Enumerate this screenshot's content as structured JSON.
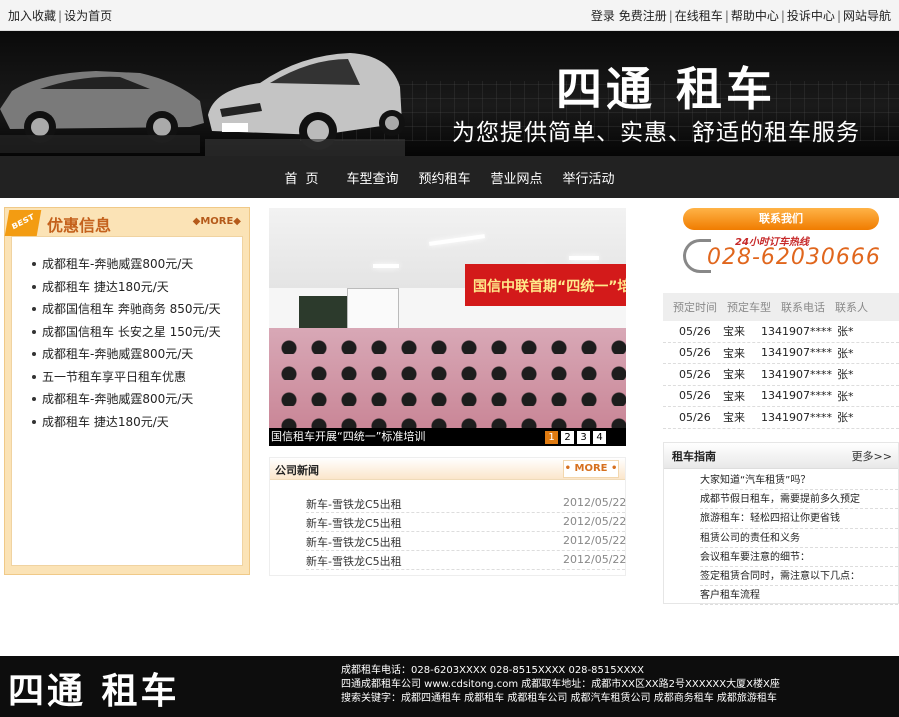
{
  "topbar": {
    "left": [
      "加入收藏",
      "设为首页"
    ],
    "right": [
      "登录",
      "免费注册",
      "在线租车",
      "帮助中心",
      "投诉中心",
      "网站导航"
    ]
  },
  "banner": {
    "brand": "四通 租车",
    "slogan": "为您提供简单、实惠、舒适的租车服务"
  },
  "nav": [
    "首页",
    "车型查询",
    "预约租车",
    "营业网点",
    "举行活动"
  ],
  "promo": {
    "badge": "BEST",
    "title": "优惠信息",
    "more": "MORE",
    "items": [
      "成都租车-奔驰威霆800元/天",
      "成都租车 捷达180元/天",
      "成都国信租车 奔驰商务 850元/天",
      "成都国信租车 长安之星 150元/天",
      "成都租车-奔驰威霆800元/天",
      "五一节租车享平日租车优惠",
      "成都租车-奔驰威霆800元/天",
      "成都租车 捷达180元/天"
    ]
  },
  "slide": {
    "banner_text": "国信中联首期“四统一”培训",
    "caption": "国信租车开展“四统一”标准培训",
    "pages": [
      "1",
      "2",
      "3",
      "4"
    ],
    "active_page": "1"
  },
  "news": {
    "title": "公司新闻",
    "more": "• MORE •",
    "items": [
      {
        "title": "新车-雪铁龙C5出租",
        "date": "2012/05/22"
      },
      {
        "title": "新车-雪铁龙C5出租",
        "date": "2012/05/22"
      },
      {
        "title": "新车-雪铁龙C5出租",
        "date": "2012/05/22"
      },
      {
        "title": "新车-雪铁龙C5出租",
        "date": "2012/05/22"
      }
    ]
  },
  "contact": {
    "button": "联系我们",
    "hotline_label": "24小时订车热线",
    "hotline_number": "028-62030666"
  },
  "booking": {
    "headers": [
      "预定时间",
      "预定车型",
      "联系电话",
      "联系人"
    ],
    "rows": [
      [
        "05/26",
        "宝来",
        "1341907****",
        "张*"
      ],
      [
        "05/26",
        "宝来",
        "1341907****",
        "张*"
      ],
      [
        "05/26",
        "宝来",
        "1341907****",
        "张*"
      ],
      [
        "05/26",
        "宝来",
        "1341907****",
        "张*"
      ],
      [
        "05/26",
        "宝来",
        "1341907****",
        "张*"
      ]
    ]
  },
  "guide": {
    "title": "租车指南",
    "more": "更多>>",
    "items": [
      "大家知道“汽车租赁”吗？",
      "成都节假日租车，需要提前多久预定",
      "旅游租车：轻松四招让你更省钱",
      "租赁公司的责任和义务",
      "会议租车要注意的细节：",
      "签定租赁合同时，需注意以下几点：",
      "客户租车流程"
    ]
  },
  "footer": {
    "logo": "四通 租车",
    "line1": "成都租车电话：028-6203XXXX 028-8515XXXX 028-8515XXXX",
    "line2": "四通成都租车公司 www.cdsitong.com 成都取车地址：成都市XX区XX路2号XXXXXX大厦X楼X座",
    "line3": "搜索关键字：成都四通租车 成都租车 成都租车公司 成都汽车租赁公司 成都商务租车 成都旅游租车"
  },
  "colors": {
    "accent": "#f07c00",
    "promo_bg": "#fbe3b6",
    "nav_bg": "#222222"
  }
}
